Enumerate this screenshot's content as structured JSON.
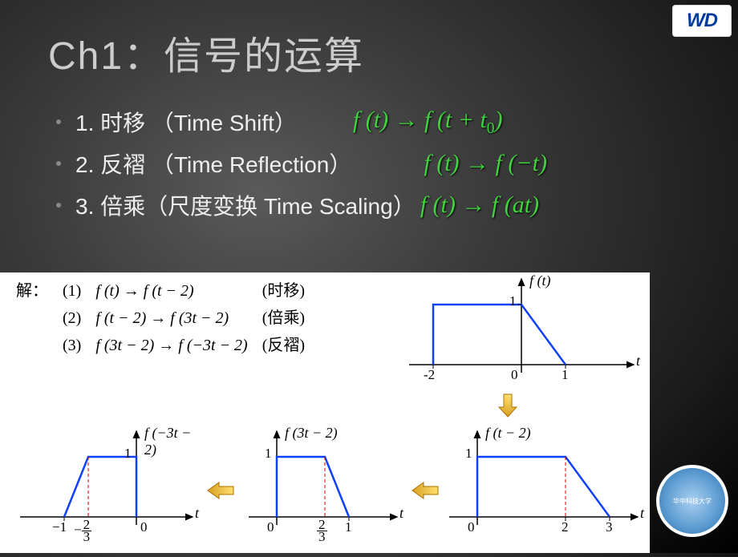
{
  "title": "Ch1：信号的运算",
  "bullets": [
    {
      "text": "1. 时移 （Time Shift）",
      "formula_html": "f (t) → f (t + t<sub class='sub'>0</sub>)"
    },
    {
      "text": "2. 反褶 （Time Reflection）",
      "formula_html": "f (t) → f (−t)"
    },
    {
      "text": "3. 倍乘（尺度变换  Time Scaling）",
      "formula_html": "f (t) → f (at)"
    }
  ],
  "solution_label": "解：",
  "solution": [
    {
      "num": "(1)",
      "expr": "f (t) → f (t − 2)",
      "kind": "(时移)"
    },
    {
      "num": "(2)",
      "expr": "f (t − 2) → f (3t − 2)",
      "kind": "(倍乘)"
    },
    {
      "num": "(3)",
      "expr": "f (3t − 2) → f (−3t − 2)",
      "kind": "(反褶)"
    }
  ],
  "chart_data": [
    {
      "type": "line",
      "label": "f (t)",
      "xlabel": "t",
      "ylabel": "",
      "ylim": [
        0,
        1
      ],
      "ytick": 1,
      "xticks": [
        -2,
        0,
        1
      ],
      "points": [
        [
          -2,
          0
        ],
        [
          -2,
          1
        ],
        [
          0,
          1
        ],
        [
          1,
          0
        ]
      ]
    },
    {
      "type": "line",
      "label": "f (t − 2)",
      "xlabel": "t",
      "ylim": [
        0,
        1
      ],
      "ytick": 1,
      "xticks": [
        0,
        2,
        3
      ],
      "points": [
        [
          0,
          0
        ],
        [
          0,
          1
        ],
        [
          2,
          1
        ],
        [
          3,
          0
        ]
      ]
    },
    {
      "type": "line",
      "label": "f (3t − 2)",
      "xlabel": "t",
      "ylim": [
        0,
        1
      ],
      "ytick": 1,
      "xticks": [
        0,
        "2/3",
        1
      ],
      "xtick_values": [
        0,
        0.667,
        1
      ],
      "points": [
        [
          0,
          0
        ],
        [
          0,
          1
        ],
        [
          0.667,
          1
        ],
        [
          1,
          0
        ]
      ]
    },
    {
      "type": "line",
      "label": "f (−3t − 2)",
      "xlabel": "t",
      "ylim": [
        0,
        1
      ],
      "ytick": 1,
      "xticks": [
        -1,
        "−2/3",
        0
      ],
      "xtick_values": [
        -1,
        -0.667,
        0
      ],
      "points": [
        [
          -1,
          0
        ],
        [
          -0.667,
          1
        ],
        [
          0,
          1
        ],
        [
          0,
          0
        ]
      ]
    }
  ],
  "logo_top": "WD",
  "logo_bottom": "华中科技大学"
}
